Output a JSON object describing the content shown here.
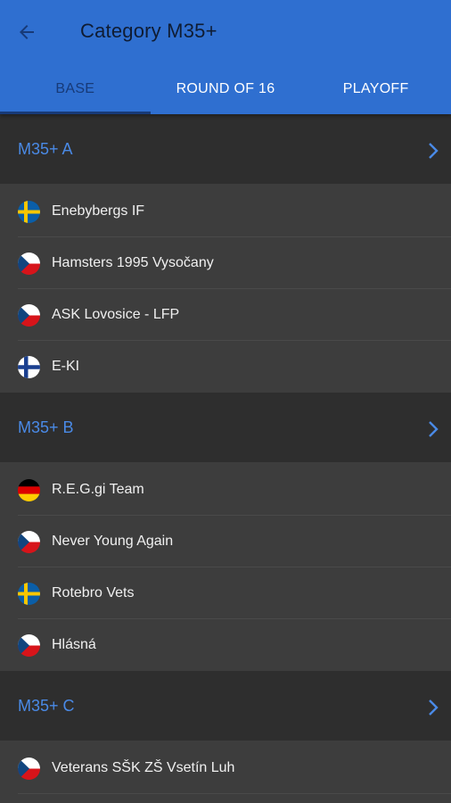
{
  "header": {
    "title": "Category M35+",
    "tabs": [
      {
        "label": "BASE",
        "active": true
      },
      {
        "label": "ROUND OF 16",
        "active": false
      },
      {
        "label": "PLAYOFF",
        "active": false
      }
    ]
  },
  "colors": {
    "appbar": "#2f6fd0",
    "group_name": "#4a8ae6",
    "background": "#3d3d3d",
    "group_header_bg": "#2e2e2e"
  },
  "groups": [
    {
      "name": "M35+ A",
      "teams": [
        {
          "name": "Enebybergs IF",
          "flag": "se"
        },
        {
          "name": "Hamsters 1995 Vysočany",
          "flag": "cz"
        },
        {
          "name": "ASK Lovosice - LFP",
          "flag": "cz"
        },
        {
          "name": "E-KI",
          "flag": "fi"
        }
      ]
    },
    {
      "name": "M35+ B",
      "teams": [
        {
          "name": "R.E.G.gi Team",
          "flag": "de"
        },
        {
          "name": "Never Young Again",
          "flag": "cz"
        },
        {
          "name": "Rotebro Vets",
          "flag": "se"
        },
        {
          "name": "Hlásná",
          "flag": "cz"
        }
      ]
    },
    {
      "name": "M35+ C",
      "teams": [
        {
          "name": "Veterans SŠK ZŠ Vsetín Luh",
          "flag": "cz"
        }
      ]
    }
  ]
}
